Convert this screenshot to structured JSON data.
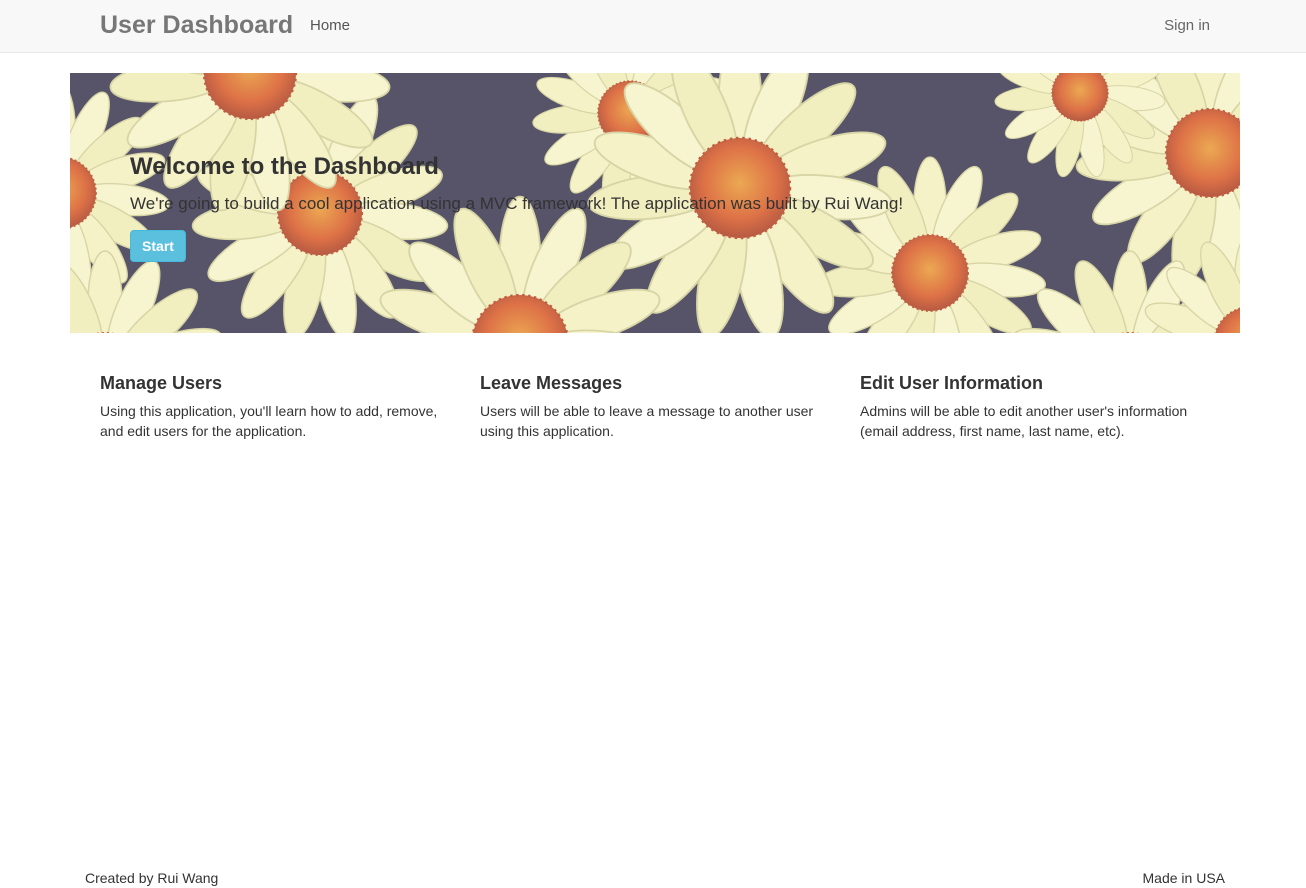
{
  "navbar": {
    "brand": "User Dashboard",
    "home_label": "Home",
    "signin_label": "Sign in"
  },
  "hero": {
    "title": "Welcome to the Dashboard",
    "text": "We're going to build a cool application using a MVC framework! The application was built by Rui Wang!",
    "button_label": "Start",
    "background": "daisy-flowers-photo"
  },
  "features": [
    {
      "title": "Manage Users",
      "text": "Using this application, you'll learn how to add, remove, and edit users for the application."
    },
    {
      "title": "Leave Messages",
      "text": "Users will be able to leave a message to another user using this application."
    },
    {
      "title": "Edit User Information",
      "text": "Admins will be able to edit another user's information (email address, first name, last name, etc)."
    }
  ],
  "footer": {
    "left": "Created by Rui Wang",
    "right": "Made in USA"
  },
  "colors": {
    "navbar_bg": "#f8f8f8",
    "start_button": "#5bc0de",
    "petal": "#f3f1c9",
    "flower_center": "#d6542c",
    "hero_dark": "#2b2a4f"
  }
}
